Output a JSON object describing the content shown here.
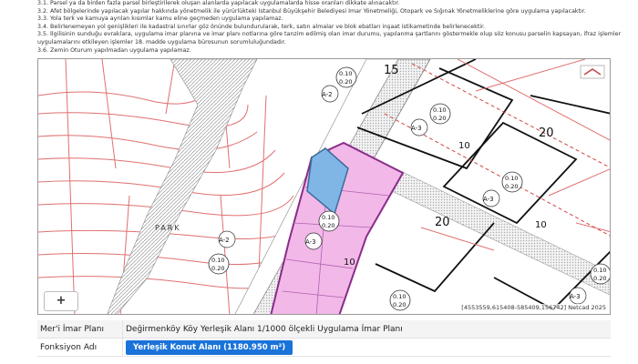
{
  "notes": [
    "3.1. Parsel ya da birden fazla parsel birleştirilerek oluşan alanlarda yapılacak uygulamalarda hisse oranları dikkate alınacaktır.",
    "3.2. Afet bölgelerinde yapılacak yapılar hakkında yönetmelik ile yürürlükteki İstanbul Büyükşehir Belediyesi İmar Yönetmeliği, Otopark ve Sığınak Yönetmeliklerine göre uygulama yapılacaktır.",
    "3.3. Yola terk ve kamuya ayrılan kısımlar kamu eline geçmeden uygulama yapılamaz.",
    "3.4. Belirlenemeyen yol genişlikleri ile kadastral sınırlar göz önünde bulundurularak, terk, satın almalar ve blok ebatları inşaat istikametinde belirlenecektir.",
    "3.5. İlgilisinin sunduğu evraklara, uygulama imar planına ve imar planı notlarına göre tanzim edilmiş olan imar durumu, yapılanma şartlarını göstermekle olup söz konusu parselin kapsayan, ifraz işlemlerinden kaynaklanan ve imar",
    "uygulamalarını etkileyen işlemler 18. madde uygulama bürosunun sorumluluğundadır.",
    "3.6. Zemin Oturum yapılmadan uygulama yapılamaz."
  ],
  "map": {
    "park_label": "PARK",
    "road_labels": [
      "15",
      "20",
      "20",
      "10",
      "10",
      "10"
    ],
    "density": [
      "0.10",
      "0.20"
    ],
    "floors": [
      "A-2",
      "A-3"
    ],
    "coordinates_text": "[4553559,615408-585409,156742] Netcad 2025",
    "zoom_in": "+"
  },
  "info": {
    "rows": [
      {
        "key": "Mer'i İmar Planı",
        "value": "Değirmenköy Köy Yerleşik Alanı 1/1000 ölçekli Uygulama İmar Planı"
      },
      {
        "key": "Fonksiyon Adı",
        "value": "Yerleşik Konut Alanı (1180.950 m²)"
      }
    ]
  },
  "colors": {
    "residential": "#f2b8e8",
    "parcel_highlight": "#7fb6e6",
    "boundary": "#8a2c8a",
    "road_red": "#e07070"
  }
}
